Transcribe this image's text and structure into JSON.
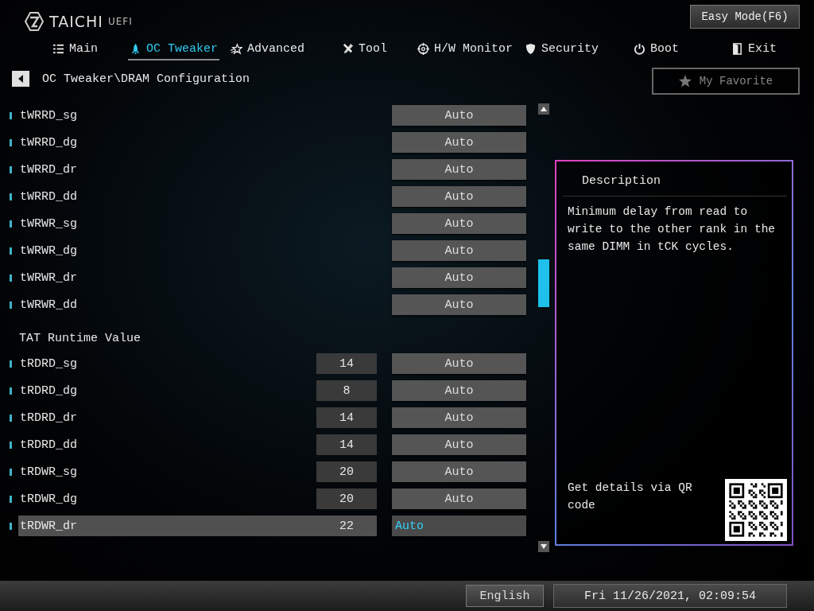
{
  "logo": {
    "brand": "TAICHI",
    "suffix": "UEFI"
  },
  "easy_mode_button": "Easy Mode(F6)",
  "tabs": [
    {
      "label": "Main",
      "selected": false
    },
    {
      "label": "OC Tweaker",
      "selected": true
    },
    {
      "label": "Advanced",
      "selected": false
    },
    {
      "label": "Tool",
      "selected": false
    },
    {
      "label": "H/W Monitor",
      "selected": false
    },
    {
      "label": "Security",
      "selected": false
    },
    {
      "label": "Boot",
      "selected": false
    },
    {
      "label": "Exit",
      "selected": false
    }
  ],
  "breadcrumb": "OC Tweaker\\DRAM Configuration",
  "favorite_button": "My Favorite",
  "settings": [
    {
      "kind": "setting",
      "name": "tWRRD_sg",
      "option": "Auto",
      "selected": false
    },
    {
      "kind": "setting",
      "name": "tWRRD_dg",
      "option": "Auto",
      "selected": false
    },
    {
      "kind": "setting",
      "name": "tWRRD_dr",
      "option": "Auto",
      "selected": false
    },
    {
      "kind": "setting",
      "name": "tWRRD_dd",
      "option": "Auto",
      "selected": false
    },
    {
      "kind": "setting",
      "name": "tWRWR_sg",
      "option": "Auto",
      "selected": false
    },
    {
      "kind": "setting",
      "name": "tWRWR_dg",
      "option": "Auto",
      "selected": false
    },
    {
      "kind": "setting",
      "name": "tWRWR_dr",
      "option": "Auto",
      "selected": false
    },
    {
      "kind": "setting",
      "name": "tWRWR_dd",
      "option": "Auto",
      "selected": false
    },
    {
      "kind": "header",
      "name": "TAT Runtime Value"
    },
    {
      "kind": "setting",
      "name": "tRDRD_sg",
      "value": "14",
      "option": "Auto",
      "selected": false
    },
    {
      "kind": "setting",
      "name": "tRDRD_dg",
      "value": "8",
      "option": "Auto",
      "selected": false
    },
    {
      "kind": "setting",
      "name": "tRDRD_dr",
      "value": "14",
      "option": "Auto",
      "selected": false
    },
    {
      "kind": "setting",
      "name": "tRDRD_dd",
      "value": "14",
      "option": "Auto",
      "selected": false
    },
    {
      "kind": "setting",
      "name": "tRDWR_sg",
      "value": "20",
      "option": "Auto",
      "selected": false
    },
    {
      "kind": "setting",
      "name": "tRDWR_dg",
      "value": "20",
      "option": "Auto",
      "selected": false
    },
    {
      "kind": "setting",
      "name": "tRDWR_dr",
      "value": "22",
      "option": "Auto",
      "selected": true
    }
  ],
  "description": {
    "title": "Description",
    "text": "Minimum delay from read to write to the other rank in the same DIMM in tCK cycles.",
    "qr_hint": "Get details via QR code"
  },
  "status_bar": {
    "language": "English",
    "datetime": "Fri 11/26/2021, 02:09:54"
  }
}
